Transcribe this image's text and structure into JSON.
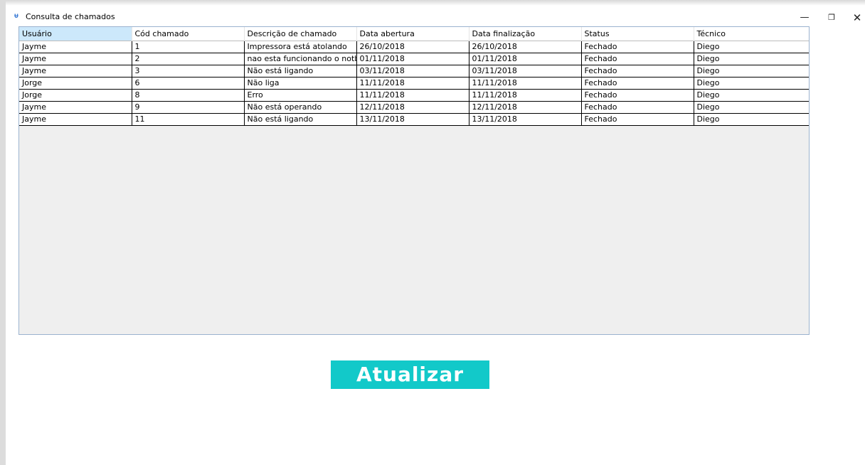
{
  "window": {
    "title": "Consulta de chamados",
    "icon": "app-icon",
    "controls": {
      "minimize": "—",
      "maximize": "❐",
      "close": "✕"
    }
  },
  "table": {
    "columns": [
      "Usuário",
      "Cód chamado",
      "Descrição de chamado",
      "Data abertura",
      "Data finalização",
      "Status",
      "Técnico"
    ],
    "rows": [
      [
        "Jayme",
        "1",
        "Impressora está atolando",
        "26/10/2018",
        "26/10/2018",
        "Fechado",
        "Diego"
      ],
      [
        "Jayme",
        "2",
        "nao esta funcionando o notboo(",
        "01/11/2018",
        "01/11/2018",
        "Fechado",
        "Diego"
      ],
      [
        "Jayme",
        "3",
        "Não está ligando",
        "03/11/2018",
        "03/11/2018",
        "Fechado",
        "Diego"
      ],
      [
        "Jorge",
        "6",
        "Não liga",
        "11/11/2018",
        "11/11/2018",
        "Fechado",
        "Diego"
      ],
      [
        "Jorge",
        "8",
        "Erro",
        "11/11/2018",
        "11/11/2018",
        "Fechado",
        "Diego"
      ],
      [
        "Jayme",
        "9",
        "Não está operando",
        "12/11/2018",
        "12/11/2018",
        "Fechado",
        "Diego"
      ],
      [
        "Jayme",
        "11",
        "Não está ligando",
        "13/11/2018",
        "13/11/2018",
        "Fechado",
        "Diego"
      ]
    ]
  },
  "actions": {
    "update_label": "Atualizar",
    "update_color": "#12c9c9"
  }
}
